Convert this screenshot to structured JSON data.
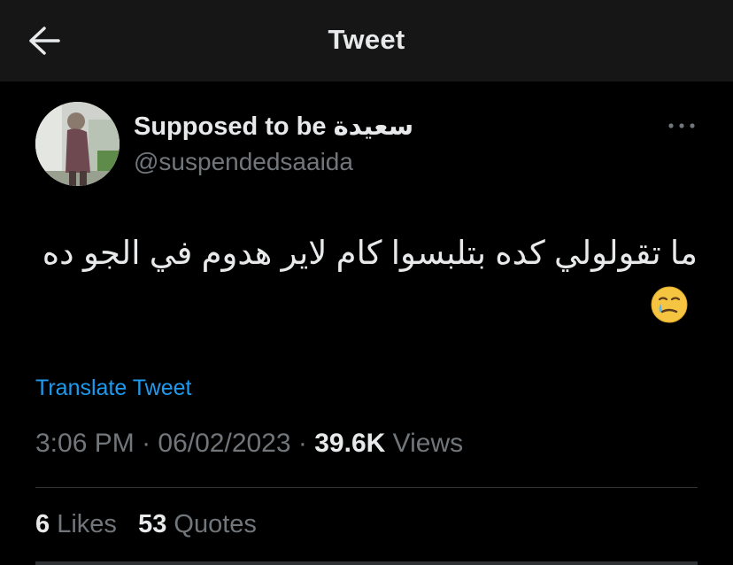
{
  "header": {
    "title": "Tweet",
    "back_icon": "arrow-left-icon"
  },
  "author": {
    "display_name": "Supposed to be سعيدة",
    "handle": "@suspendedsaaida",
    "avatar": "avatar-photo"
  },
  "more_icon": "more-horizontal-icon",
  "tweet": {
    "text": "ما تقولولي كده بتلبسوا كام لاير هدوم في الجو ده",
    "emoji": "🥲",
    "emoji_icon": "smiling-face-with-tear-icon"
  },
  "translate_label": "Translate Tweet",
  "meta": {
    "time": "3:06 PM",
    "sep1": " · ",
    "date": "06/02/2023",
    "sep2": " · ",
    "views_count": "39.6K",
    "views_label": "Views"
  },
  "stats": {
    "likes_count": "6",
    "likes_label": "Likes",
    "quotes_count": "53",
    "quotes_label": "Quotes"
  },
  "colors": {
    "background": "#000000",
    "header_bg": "#161616",
    "text_primary": "#e7e9ea",
    "text_secondary": "#71767b",
    "link": "#1d9bf0",
    "divider": "#2f3336"
  }
}
